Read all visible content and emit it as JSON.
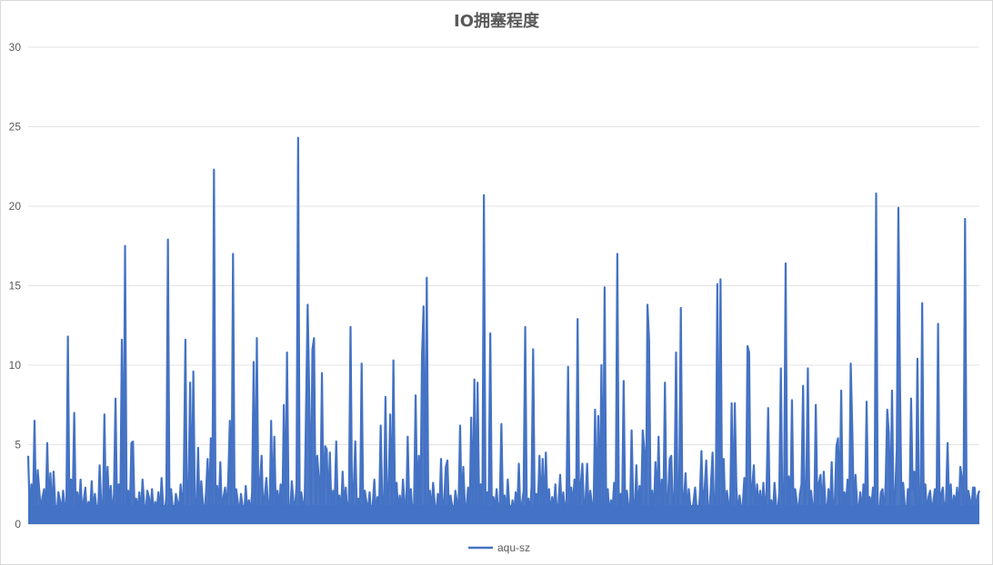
{
  "chart_data": {
    "type": "line",
    "title": "IO拥塞程度",
    "xlabel": "",
    "ylabel": "",
    "ylim": [
      0,
      30
    ],
    "yticks": [
      0,
      5,
      10,
      15,
      20,
      25,
      30
    ],
    "grid": true,
    "legend": "bottom",
    "series": [
      {
        "name": "aqu-sz",
        "color": "#4472c4",
        "values": [
          4.3,
          0.6,
          2.5,
          1.0,
          6.5,
          0.4,
          3.4,
          2.1,
          0.8,
          1.7,
          2.2,
          0.5,
          5.1,
          0.9,
          3.2,
          0.6,
          3.3,
          1.2,
          0.4,
          2.0,
          1.5,
          0.7,
          2.1,
          1.1,
          0.5,
          11.8,
          0.6,
          2.8,
          1.3,
          7.0,
          0.4,
          2.0,
          0.9,
          2.8,
          0.6,
          1.5,
          2.3,
          0.5,
          1.4,
          0.8,
          2.7,
          0.6,
          1.9,
          1.0,
          0.5,
          3.7,
          1.2,
          0.4,
          6.9,
          0.7,
          3.6,
          1.0,
          2.4,
          0.5,
          1.8,
          7.9,
          0.6,
          2.5,
          0.9,
          11.6,
          0.5,
          17.5,
          0.8,
          2.1,
          0.6,
          5.1,
          5.2,
          0.7,
          1.6,
          0.9,
          2.0,
          0.5,
          2.8,
          1.3,
          0.6,
          2.1,
          1.7,
          0.8,
          2.2,
          0.5,
          1.4,
          0.9,
          2.0,
          0.6,
          2.9,
          1.1,
          0.5,
          1.8,
          17.9,
          0.7,
          2.2,
          1.0,
          0.6,
          1.9,
          1.4,
          0.8,
          2.5,
          0.6,
          2.9,
          11.6,
          0.5,
          2.2,
          8.9,
          0.8,
          9.6,
          1.1,
          0.7,
          4.8,
          0.5,
          2.7,
          1.3,
          0.6,
          2.0,
          4.1,
          1.1,
          5.4,
          0.8,
          22.3,
          0.6,
          2.4,
          1.0,
          3.9,
          0.5,
          1.7,
          2.3,
          0.9,
          2.8,
          6.5,
          0.5,
          17.0,
          0.7,
          2.2,
          1.4,
          0.6,
          1.9,
          1.1,
          0.5,
          2.4,
          0.8,
          1.5,
          0.6,
          2.0,
          10.2,
          0.5,
          11.7,
          0.9,
          2.7,
          4.3,
          0.6,
          1.8,
          2.9,
          1.2,
          0.5,
          6.5,
          0.8,
          5.5,
          0.6,
          2.1,
          1.0,
          2.5,
          0.5,
          7.5,
          0.7,
          10.8,
          1.1,
          0.6,
          2.7,
          1.5,
          0.8,
          2.5,
          24.3,
          0.6,
          2.0,
          1.3,
          0.5,
          7.3,
          13.8,
          8.1,
          0.7,
          11.0,
          11.7,
          0.6,
          4.3,
          2.9,
          1.2,
          9.5,
          0.5,
          4.9,
          4.7,
          0.8,
          4.5,
          0.6,
          2.1,
          1.3,
          5.2,
          0.7,
          1.8,
          0.5,
          3.3,
          1.0,
          2.3,
          0.6,
          1.5,
          12.4,
          0.9,
          2.2,
          5.2,
          0.6,
          1.6,
          1.0,
          10.1,
          0.5,
          2.1,
          1.4,
          0.8,
          2.0,
          0.6,
          1.2,
          2.8,
          0.5,
          1.7,
          0.9,
          6.2,
          1.2,
          0.6,
          8.0,
          0.8,
          2.4,
          6.9,
          0.5,
          10.3,
          1.1,
          2.6,
          0.7,
          1.8,
          0.6,
          2.8,
          1.4,
          0.5,
          5.5,
          0.9,
          2.2,
          0.6,
          1.3,
          8.1,
          0.8,
          4.3,
          0.6,
          10.5,
          13.7,
          0.5,
          15.5,
          1.0,
          2.1,
          0.7,
          2.6,
          1.3,
          0.6,
          1.9,
          0.9,
          4.1,
          0.5,
          1.5,
          3.6,
          4.0,
          0.7,
          1.8,
          1.1,
          0.6,
          2.1,
          1.4,
          0.8,
          6.2,
          0.5,
          3.6,
          1.2,
          0.9,
          2.3,
          0.6,
          6.7,
          0.8,
          9.1,
          0.5,
          8.9,
          1.0,
          2.5,
          0.6,
          20.7,
          0.7,
          2.0,
          1.3,
          12.0,
          0.5,
          1.7,
          0.9,
          2.2,
          0.6,
          1.4,
          6.3,
          0.8,
          1.8,
          0.5,
          2.8,
          1.1,
          0.7,
          1.5,
          0.6,
          2.0,
          0.9,
          3.8,
          0.5,
          1.3,
          2.1,
          12.4,
          0.8,
          1.6,
          0.6,
          2.4,
          11.0,
          0.5,
          1.9,
          1.2,
          4.3,
          0.7,
          4.1,
          0.6,
          4.5,
          1.0,
          2.2,
          0.5,
          1.7,
          0.9,
          2.5,
          0.6,
          1.3,
          3.1,
          0.8,
          2.0,
          0.5,
          1.6,
          9.9,
          0.7,
          2.3,
          1.1,
          2.8,
          0.6,
          12.9,
          0.5,
          2.5,
          3.8,
          0.9,
          1.4,
          3.8,
          0.6,
          2.1,
          1.2,
          0.5,
          7.2,
          0.8,
          6.8,
          1.1,
          10.0,
          0.6,
          14.9,
          0.7,
          2.2,
          0.5,
          1.5,
          0.9,
          2.6,
          1.3,
          17.0,
          0.6,
          1.9,
          0.8,
          9.0,
          0.5,
          2.1,
          1.1,
          0.6,
          5.9,
          1.4,
          0.7,
          3.7,
          0.5,
          2.4,
          0.9,
          5.9,
          4.7,
          0.6,
          13.8,
          11.6,
          0.8,
          2.1,
          0.5,
          3.9,
          1.2,
          5.5,
          0.6,
          2.8,
          0.9,
          8.9,
          0.5,
          1.7,
          4.1,
          4.3,
          0.7,
          2.0,
          10.8,
          0.6,
          2.4,
          13.6,
          0.8,
          1.6,
          3.2,
          0.5,
          2.2,
          1.1,
          0.6,
          1.4,
          2.3,
          0.9,
          0.5,
          1.8,
          4.6,
          0.7,
          2.2,
          4.0,
          1.2,
          0.6,
          2.5,
          4.5,
          0.8,
          1.5,
          15.1,
          0.5,
          15.4,
          0.9,
          4.1,
          0.6,
          2.1,
          1.3,
          0.5,
          7.6,
          0.7,
          7.6,
          2.2,
          0.6,
          1.8,
          0.9,
          1.2,
          2.9,
          0.5,
          11.2,
          10.8,
          0.7,
          2.4,
          3.7,
          0.6,
          2.5,
          1.1,
          2.1,
          0.8,
          2.6,
          0.5,
          2.2,
          7.3,
          0.9,
          1.5,
          0.6,
          2.6,
          1.2,
          0.7,
          2.0,
          9.8,
          0.5,
          1.6,
          16.4,
          0.9,
          3.0,
          0.6,
          7.8,
          0.7,
          2.2,
          1.4,
          0.5,
          1.9,
          2.5,
          8.7,
          0.8,
          2.3,
          9.8,
          0.6,
          2.1,
          1.1,
          0.5,
          7.5,
          0.9,
          2.6,
          3.1,
          0.7,
          3.3,
          1.3,
          0.6,
          2.2,
          0.8,
          3.9,
          0.5,
          1.5,
          4.9,
          5.4,
          0.9,
          8.4,
          0.6,
          2.0,
          1.2,
          2.8,
          0.7,
          10.1,
          5.9,
          0.5,
          3.1,
          1.3,
          0.8,
          2.0,
          0.6,
          2.5,
          0.9,
          7.7,
          0.5,
          1.7,
          1.0,
          2.3,
          0.6,
          20.8,
          1.2,
          0.7,
          2.0,
          2.2,
          0.5,
          2.6,
          7.2,
          5.7,
          0.8,
          8.4,
          0.6,
          1.9,
          4.7,
          19.9,
          9.0,
          0.7,
          2.6,
          1.2,
          0.5,
          2.2,
          0.8,
          7.9,
          2.2,
          3.3,
          0.6,
          10.4,
          0.9,
          0.5,
          13.9,
          1.0,
          2.5,
          0.6,
          1.7,
          2.1,
          0.8,
          1.4,
          2.2,
          0.5,
          12.6,
          0.7,
          1.9,
          2.3,
          0.6,
          1.5,
          5.1,
          0.9,
          2.5,
          0.5,
          1.8,
          1.2,
          2.3,
          0.6,
          3.6,
          2.9,
          0.8,
          19.2,
          0.5,
          2.1,
          1.6,
          0.9,
          2.3,
          2.3,
          0.7,
          1.8,
          2.1
        ]
      }
    ]
  }
}
